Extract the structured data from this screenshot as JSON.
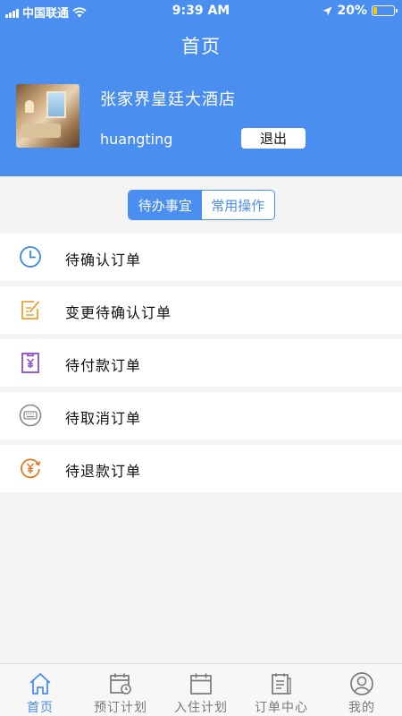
{
  "status_bar": {
    "carrier": "中国联通",
    "time": "9:39 AM",
    "battery": "20%",
    "battery_level": 0.2
  },
  "header": {
    "title": "首页",
    "hotel_name": "张家界皇廷大酒店",
    "username": "huangting",
    "logout_label": "退出"
  },
  "segment": {
    "tabs": [
      {
        "label": "待办事宜",
        "active": true
      },
      {
        "label": "常用操作",
        "active": false
      }
    ]
  },
  "todo_list": [
    {
      "label": "待确认订单",
      "icon": "clock-icon",
      "color": "#3a86e6"
    },
    {
      "label": "变更待确认订单",
      "icon": "edit-note-icon",
      "color": "#f0a030"
    },
    {
      "label": "待付款订单",
      "icon": "yen-clipboard-icon",
      "color": "#8a4cc9"
    },
    {
      "label": "待取消订单",
      "icon": "keyboard-icon",
      "color": "#888888"
    },
    {
      "label": "待退款订单",
      "icon": "yen-refund-icon",
      "color": "#e07a20"
    }
  ],
  "tabbar": {
    "items": [
      {
        "label": "首页",
        "icon": "home-icon",
        "active": true
      },
      {
        "label": "预订计划",
        "icon": "calendar-clock-icon",
        "active": false
      },
      {
        "label": "入住计划",
        "icon": "calendar-icon",
        "active": false
      },
      {
        "label": "订单中心",
        "icon": "document-icon",
        "active": false
      },
      {
        "label": "我的",
        "icon": "user-icon",
        "active": false
      }
    ]
  },
  "colors": {
    "accent": "#4a8ef0",
    "tab_inactive": "#7a7a7a"
  }
}
